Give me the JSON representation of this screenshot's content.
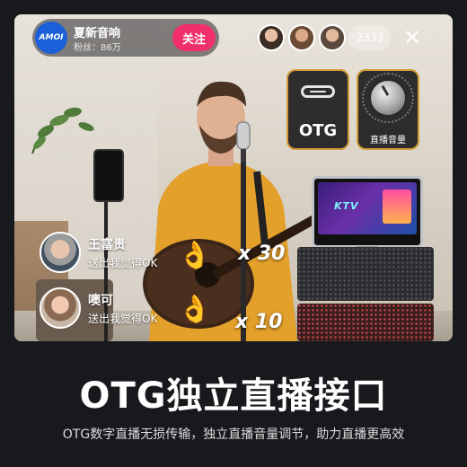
{
  "host": {
    "logo_text": "AMOI",
    "name": "夏新音响",
    "fans": "粉丝：86万",
    "follow_label": "关注"
  },
  "viewers": {
    "count": "2333"
  },
  "close_symbol": "✕",
  "features": {
    "otg_label": "OTG",
    "volume_label": "直播音量"
  },
  "comments": [
    {
      "name": "王富贵",
      "text": "送出我觉得OK"
    },
    {
      "name": "噢可",
      "text": "送出我觉得OK"
    }
  ],
  "gifts": [
    {
      "icon": "👌",
      "count": "x 30"
    },
    {
      "icon": "👌",
      "count": "x 10"
    }
  ],
  "caption": {
    "title": "OTG独立直播接口",
    "subtitle": "OTG数字直播无损传输，独立直播音量调节，助力直播更高效"
  },
  "colors": {
    "background": "#18191d",
    "follow_button": "#f1306b",
    "tile_border": "#d49b3a",
    "host_logo": "#1b5fd9"
  }
}
